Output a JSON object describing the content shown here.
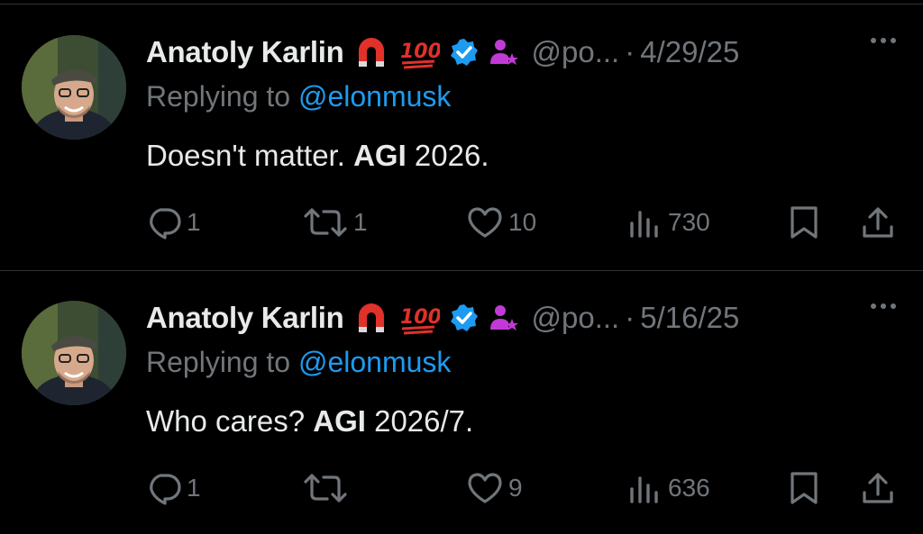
{
  "tweets": [
    {
      "author": "Anatoly Karlin",
      "handle": "@po...",
      "separator": "·",
      "date": "4/29/25",
      "reply_prefix": "Replying to ",
      "reply_mention": "@elonmusk",
      "text_before": "Doesn't matter. ",
      "text_bold": "AGI",
      "text_after": " 2026.",
      "replies": "1",
      "reposts": "1",
      "likes": "10",
      "views": "730"
    },
    {
      "author": "Anatoly Karlin",
      "handle": "@po...",
      "separator": "·",
      "date": "5/16/25",
      "reply_prefix": "Replying to ",
      "reply_mention": "@elonmusk",
      "text_before": "Who cares? ",
      "text_bold": "AGI",
      "text_after": " 2026/7.",
      "replies": "1",
      "reposts": "",
      "likes": "9",
      "views": "636"
    }
  ],
  "icons": {
    "magnet": "magnet-icon",
    "hundred": "hundred-points-icon",
    "verified": "verified-badge-icon",
    "affiliate": "affiliate-icon",
    "more": "more-icon",
    "reply": "reply-icon",
    "repost": "repost-icon",
    "like": "like-icon",
    "views": "views-icon",
    "bookmark": "bookmark-icon",
    "share": "share-icon"
  },
  "colors": {
    "background": "#000000",
    "text": "#e7e9ea",
    "muted": "#71767b",
    "link": "#1d9bf0",
    "verified": "#1d9bf0",
    "affiliate": "#c13ad6",
    "magnet": "#e0312b",
    "hundred": "#e0312b"
  }
}
